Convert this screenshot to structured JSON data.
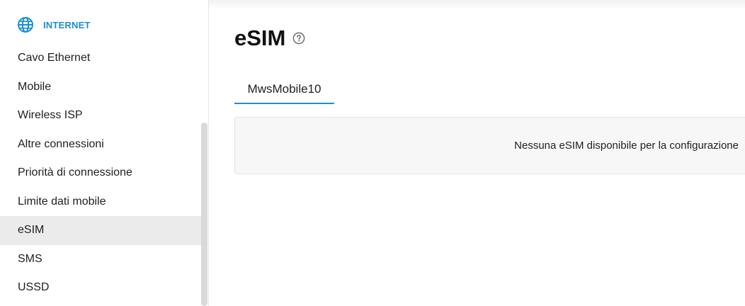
{
  "sidebar": {
    "section": {
      "label": "INTERNET",
      "icon": "globe-icon",
      "color": "#1a8fd1"
    },
    "items": [
      {
        "label": "Cavo Ethernet"
      },
      {
        "label": "Mobile"
      },
      {
        "label": "Wireless ISP"
      },
      {
        "label": "Altre connessioni"
      },
      {
        "label": "Priorità di connessione"
      },
      {
        "label": "Limite dati mobile"
      },
      {
        "label": "eSIM",
        "active": true
      },
      {
        "label": "SMS"
      },
      {
        "label": "USSD"
      }
    ]
  },
  "main": {
    "title": "eSIM",
    "help_icon": "help-circle-icon",
    "tabs": [
      {
        "label": "MwsMobile10",
        "active": true
      }
    ],
    "panel": {
      "message": "Nessuna eSIM disponibile per la configurazione"
    }
  },
  "colors": {
    "accent": "#1a8fd1",
    "active_item_bg": "#ebebeb"
  }
}
